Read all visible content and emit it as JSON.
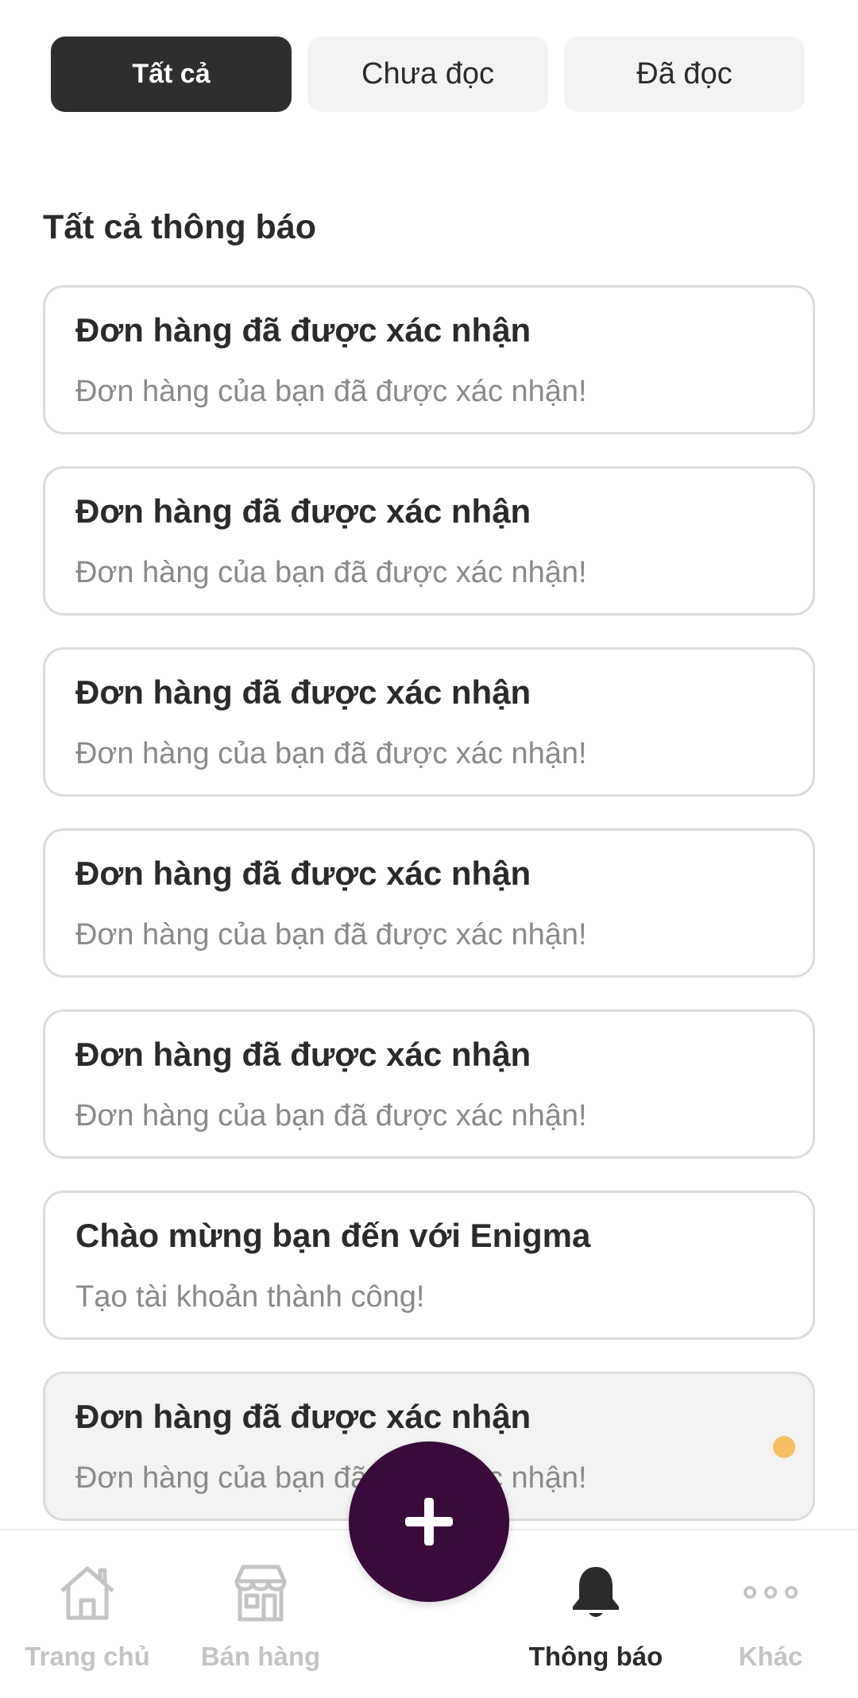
{
  "tabs": [
    {
      "label": "Tất cả",
      "active": true
    },
    {
      "label": "Chưa đọc",
      "active": false
    },
    {
      "label": "Đã đọc",
      "active": false
    }
  ],
  "section_title": "Tất cả thông báo",
  "notifications": [
    {
      "title": "Đơn hàng đã được xác nhận",
      "body": "Đơn hàng của bạn đã được xác nhận!",
      "unread": false
    },
    {
      "title": "Đơn hàng đã được xác nhận",
      "body": "Đơn hàng của bạn đã được xác nhận!",
      "unread": false
    },
    {
      "title": "Đơn hàng đã được xác nhận",
      "body": "Đơn hàng của bạn đã được xác nhận!",
      "unread": false
    },
    {
      "title": "Đơn hàng đã được xác nhận",
      "body": "Đơn hàng của bạn đã được xác nhận!",
      "unread": false
    },
    {
      "title": "Đơn hàng đã được xác nhận",
      "body": "Đơn hàng của bạn đã được xác nhận!",
      "unread": false
    },
    {
      "title": "Chào mừng bạn đến với Enigma",
      "body": "Tạo tài khoản thành công!",
      "unread": false
    },
    {
      "title": "Đơn hàng đã được xác nhận",
      "body": "Đơn hàng của bạn đã được xác nhận!",
      "unread": true
    }
  ],
  "bottom_nav": {
    "items": [
      {
        "label": "Trang chủ",
        "icon": "home-icon",
        "active": false
      },
      {
        "label": "Bán hàng",
        "icon": "store-icon",
        "active": false
      },
      {
        "label": "Thông báo",
        "icon": "bell-icon",
        "active": true
      },
      {
        "label": "Khác",
        "icon": "more-icon",
        "active": false
      }
    ],
    "fab_icon": "plus-icon"
  },
  "colors": {
    "tab_active_bg": "#2e2e2e",
    "fab_bg": "#3a0a3c",
    "unread_dot": "#f6c063",
    "unread_card_bg": "#f3f3f3",
    "nav_inactive": "#c4c4c4"
  }
}
